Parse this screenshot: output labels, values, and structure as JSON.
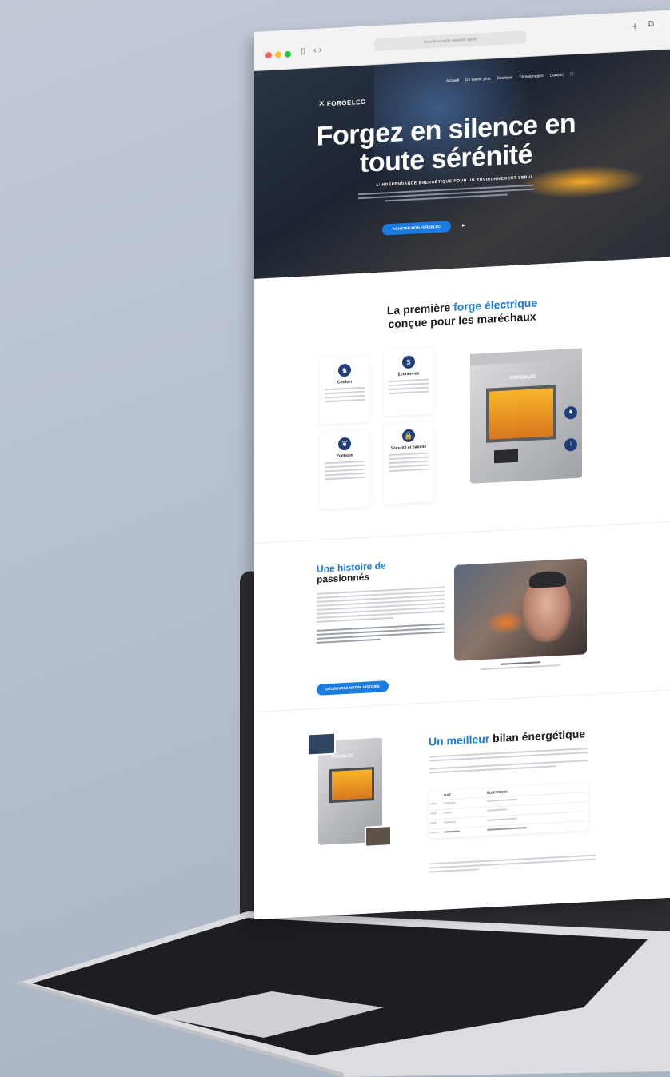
{
  "browser": {
    "url_placeholder": "Search or enter website name"
  },
  "hero": {
    "logo": "FORGELEC",
    "nav": [
      "Accueil",
      "En savoir plus",
      "Boutique",
      "Témoignages",
      "Contact"
    ],
    "title": "Forgez en silence en toute sérénité",
    "subtitle": "L'INDÉPENDANCE ÉNERGÉTIQUE POUR UN ENVIRONNEMENT SERVI",
    "cta_label": "ACHETER MON FORGELEC"
  },
  "features": {
    "title_prefix": "La première ",
    "title_accent": "forge électrique",
    "title_suffix": "conçue pour les maréchaux",
    "cards": [
      {
        "title": "Confort",
        "icon": "horse-icon"
      },
      {
        "title": "Économies",
        "icon": "dollar-icon"
      },
      {
        "title": "Écologie",
        "icon": "leaf-icon"
      },
      {
        "title": "Sécurité et fiabilité",
        "icon": "lock-icon"
      }
    ],
    "product_brand": "FORGELEC"
  },
  "story": {
    "title_accent": "Une histoire de",
    "title_rest": "passionnés",
    "cta_label": "DÉCOUVREZ NOTRE HISTOIRE"
  },
  "energy": {
    "title_accent": "Un meilleur",
    "title_rest": "bilan énergétique",
    "product_brand": "FORGELEC",
    "table": {
      "headers": [
        "",
        "GAZ",
        "ÉLECTRIQUE"
      ]
    }
  },
  "colors": {
    "accent": "#1a7ce0",
    "navy": "#1f3e78"
  }
}
